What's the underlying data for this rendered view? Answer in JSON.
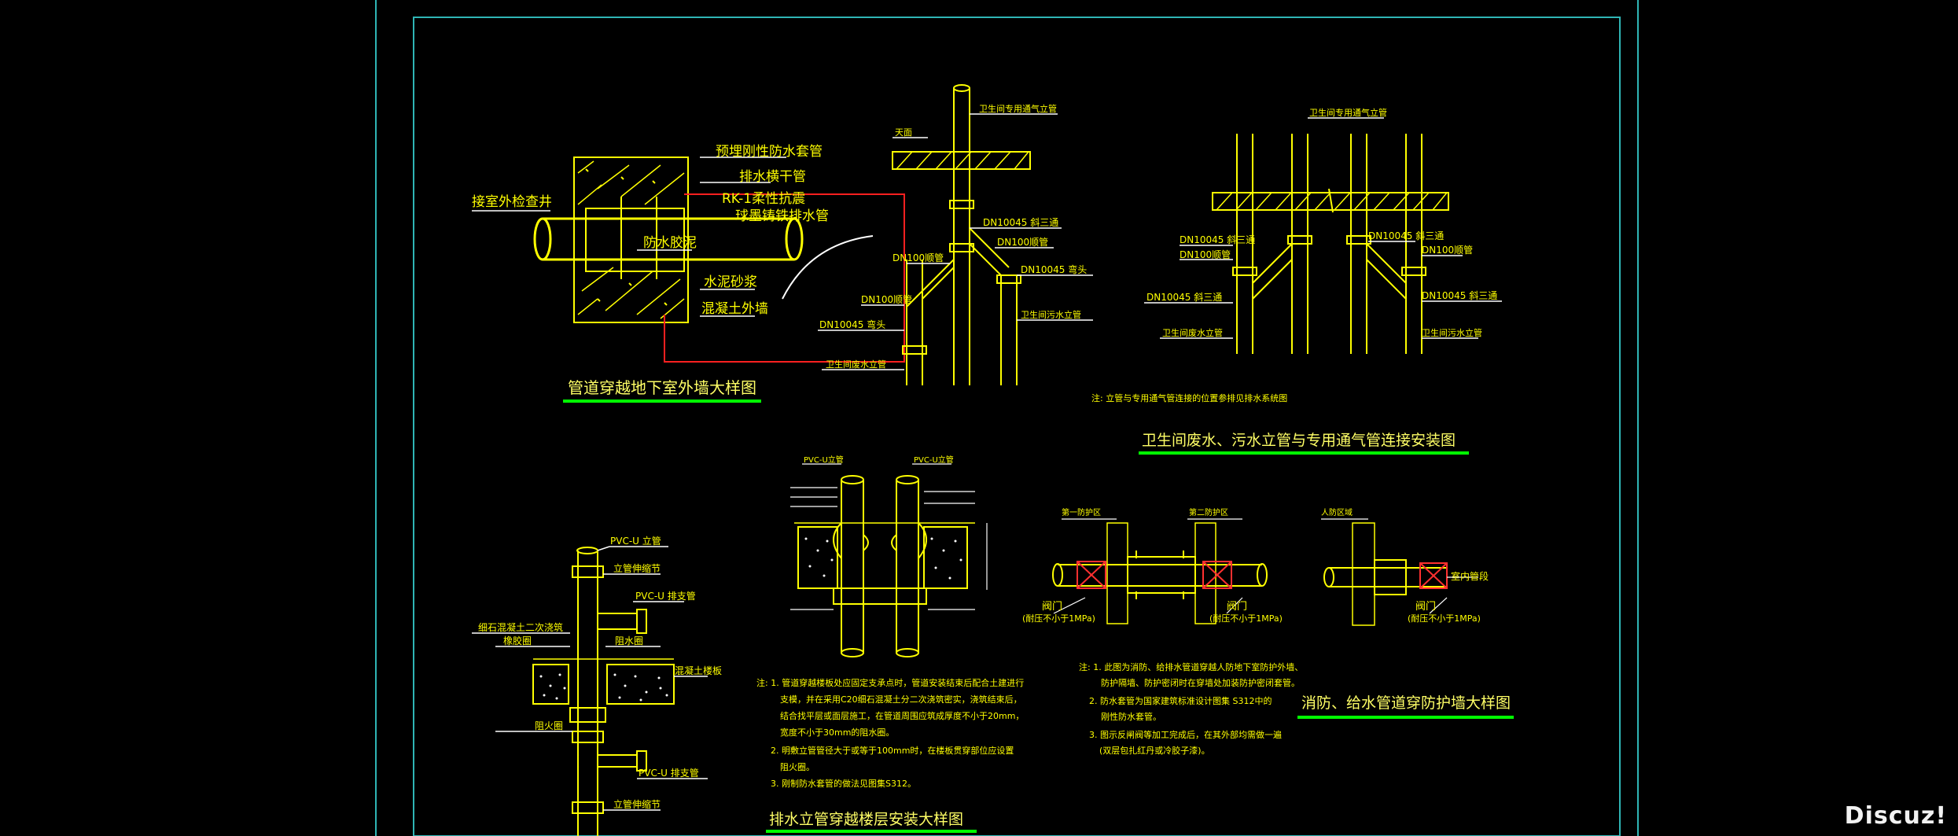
{
  "colors": {
    "background": "#000000",
    "sheet_border": "#2fb5b5",
    "pipe": "#ffff00",
    "label": "#ffff00",
    "note": "#ffff00",
    "leader": "#ffffff",
    "title_underline": "#00ff00",
    "title_text": "#ffff66",
    "red_line": "#ff2020",
    "green_text": "#00ff66",
    "valve": "#ff3030"
  },
  "watermark": "Discuz!",
  "detail1": {
    "title": "管道穿越地下室外墙大样图",
    "labels": {
      "sleeve": "预埋刚性防水套管",
      "drain_pipe": "排水横干管",
      "flex_pipe_1": "RK-1柔性抗震",
      "flex_pipe_2": "球墨铸铁排水管",
      "manhole": "接室外检查井",
      "waterproof_cement": "防水胶泥",
      "mortar": "水泥砂浆",
      "concrete_wall": "混凝土外墙"
    }
  },
  "detail2": {
    "title": "卫生间废水、污水立管与专用通气管连接安装图",
    "note": "注: 立管与专用通气管连接的位置参排见排水系统图",
    "left": {
      "vent_stack": "卫生间专用通气立管",
      "ceiling": "天面",
      "tee_1": "DN10045 斜三通",
      "reducer_1": "DN100顺管",
      "reducer_2": "DN100顺管",
      "elbow_1": "DN10045 弯头",
      "reducer_3": "DN100顺管",
      "elbow_2": "DN10045 弯头",
      "sewage_stack": "卫生间污水立管",
      "waste_stack": "卫生间废水立管"
    },
    "right": {
      "vent_stack": "卫生间专用通气立管",
      "tee_l": "DN10045 斜三通",
      "reducer_l": "DN100顺管",
      "tee_l2": "DN10045 斜三通",
      "waste_stack": "卫生间废水立管",
      "tee_r": "DN10045 斜三通",
      "reducer_r": "DN100顺管",
      "tee_r2": "DN10045 斜三通",
      "sewage_stack": "卫生间污水立管"
    }
  },
  "detail3": {
    "title": "排水立管穿越楼层安装大样图",
    "labels": {
      "pvc_stack": "PVC-U 立管",
      "expansion_1": "立管伸缩节",
      "pvc_branch_1": "PVC-U 排支管",
      "fine_concrete": "细石混凝土二次浇筑",
      "rubber_ring": "橡胶圈",
      "water_stop": "阻水圈",
      "slab": "混凝土楼板",
      "fire_ring": "阻火圈",
      "pvc_branch_2": "PVC-U 排支管",
      "expansion_2": "立管伸缩节"
    },
    "small_labels": {
      "pvc_left": "PVC-U立管",
      "pvc_right": "PVC-U立管"
    },
    "notes": [
      "注: 1. 管道穿越楼板处应固定支承点时，管道安装结束后配合土建进行",
      "支模，并在采用C20细石混凝土分二次浇筑密实，浇筑结束后，",
      "结合找平层或面层施工，在管道周围应筑成厚度不小于20mm，",
      "宽度不小于30mm的阻水圈。",
      "2. 明敷立管管径大于或等于100mm时，在楼板贯穿部位应设置",
      "阻火圈。",
      "3. 刚制防水套管的做法见图集S312。"
    ]
  },
  "detail4": {
    "title": "消防、给水管道穿防护墙大样图",
    "labels": {
      "zone_1": "第一防护区",
      "zone_2": "第二防护区",
      "valve_1": "阀门",
      "valve_1_note": "(耐压不小于1MPa)",
      "valve_2": "阀门",
      "valve_2_note": "(耐压不小于1MPa)",
      "air_defense": "人防区域",
      "indoor_pipe": "室内管段",
      "valve_3": "阀门",
      "valve_3_note": "(耐压不小于1MPa)"
    },
    "notes": [
      "注: 1. 此图为消防、给排水管道穿越人防地下室防护外墙、",
      "防护隔墙、防护密闭时在穿墙处加装防护密闭套管。",
      "2. 防水套管为国家建筑标准设计图集 S312中的",
      "刚性防水套管。",
      "3. 图示反闸阀等加工完成后，在其外部均需做一遍",
      "(双层包扎红丹或冷胶子漆)。"
    ]
  }
}
